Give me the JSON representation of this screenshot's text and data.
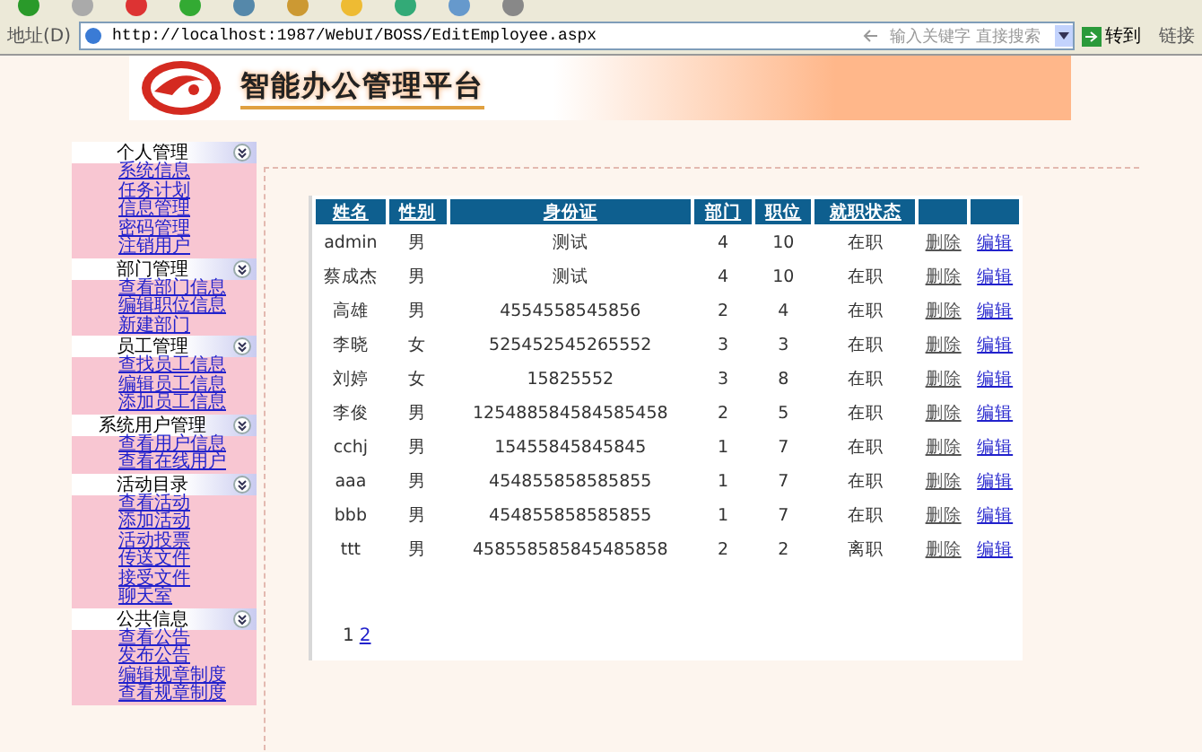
{
  "browser": {
    "address_label": "地址(D)",
    "url": "http://localhost:1987/WebUI/BOSS/EditEmployee.aspx",
    "search_placeholder": "输入关键字 直接搜索",
    "go": "转到",
    "links": "链接"
  },
  "banner": {
    "title": "智能办公管理平台"
  },
  "sidebar": [
    {
      "title": "个人管理",
      "expanded": true,
      "items": [
        "系统信息",
        "任务计划",
        "信息管理",
        "密码管理",
        "注销用户"
      ]
    },
    {
      "title": "部门管理",
      "expanded": true,
      "items": [
        "查看部门信息",
        "编辑职位信息",
        "新建部门"
      ]
    },
    {
      "title": "员工管理",
      "expanded": true,
      "items": [
        "查找员工信息",
        "编辑员工信息",
        "添加员工信息"
      ]
    },
    {
      "title": "系统用户管理",
      "expanded": true,
      "items": [
        "查看用户信息",
        "查看在线用户"
      ]
    },
    {
      "title": "活动目录",
      "expanded": true,
      "items": [
        "查看活动",
        "添加活动",
        "活动投票",
        "传送文件",
        "接受文件",
        "聊天室"
      ]
    },
    {
      "title": "公共信息",
      "expanded": true,
      "items": [
        "查看公告",
        "发布公告",
        "编辑规章制度",
        "查看规章制度"
      ]
    }
  ],
  "table": {
    "columns": [
      "姓名",
      "性别",
      "身份证",
      "部门",
      "职位",
      "就职状态"
    ],
    "rows": [
      {
        "cells": [
          "admin",
          "男",
          "测试",
          "4",
          "10",
          "在职"
        ],
        "delete": "删除",
        "edit": "编辑"
      },
      {
        "cells": [
          "蔡成杰",
          "男",
          "测试",
          "4",
          "10",
          "在职"
        ],
        "delete": "删除",
        "edit": "编辑"
      },
      {
        "cells": [
          "高雄",
          "男",
          "4554558545856",
          "2",
          "4",
          "在职"
        ],
        "delete": "删除",
        "edit": "编辑"
      },
      {
        "cells": [
          "李晓",
          "女",
          "525452545265552",
          "3",
          "3",
          "在职"
        ],
        "delete": "删除",
        "edit": "编辑"
      },
      {
        "cells": [
          "刘婷",
          "女",
          "15825552",
          "3",
          "8",
          "在职"
        ],
        "delete": "删除",
        "edit": "编辑"
      },
      {
        "cells": [
          "李俊",
          "男",
          "125488584584585458",
          "2",
          "5",
          "在职"
        ],
        "delete": "删除",
        "edit": "编辑"
      },
      {
        "cells": [
          "cchj",
          "男",
          "15455845845845",
          "1",
          "7",
          "在职"
        ],
        "delete": "删除",
        "edit": "编辑"
      },
      {
        "cells": [
          "aaa",
          "男",
          "454855858585855",
          "1",
          "7",
          "在职"
        ],
        "delete": "删除",
        "edit": "编辑"
      },
      {
        "cells": [
          "bbb",
          "男",
          "454855858585855",
          "1",
          "7",
          "在职"
        ],
        "delete": "删除",
        "edit": "编辑"
      },
      {
        "cells": [
          "ttt",
          "男",
          "458558585845485858",
          "2",
          "2",
          "离职"
        ],
        "delete": "删除",
        "edit": "编辑"
      }
    ]
  },
  "pagination": [
    {
      "label": "1",
      "selected": true
    },
    {
      "label": "2",
      "selected": false
    }
  ]
}
